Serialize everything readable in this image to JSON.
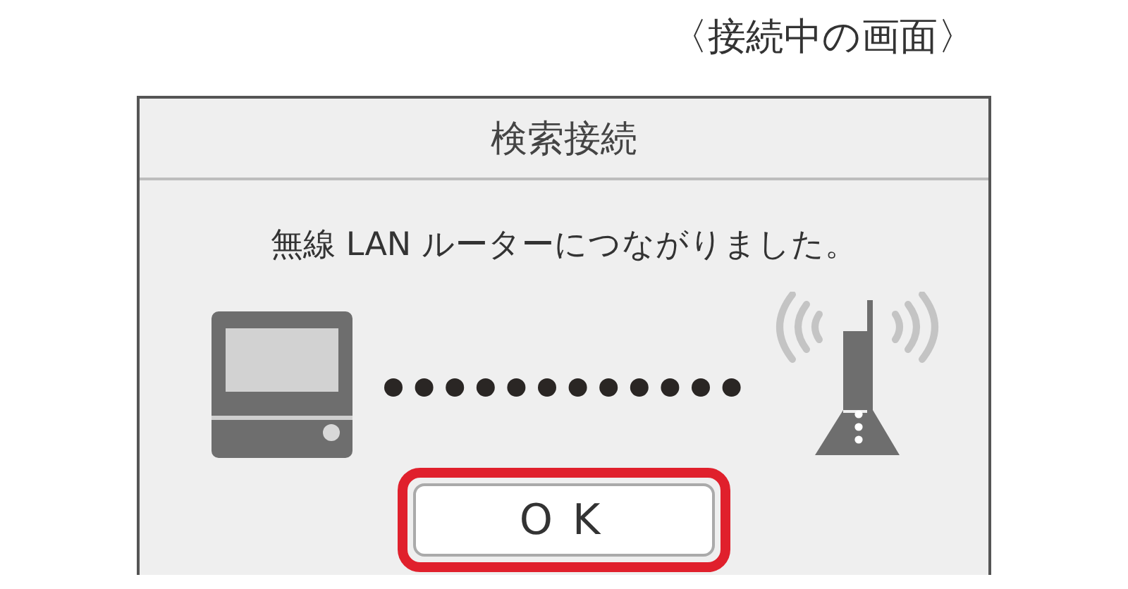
{
  "caption": "〈接続中の画面〉",
  "dialog": {
    "title": "検索接続",
    "message": "無線 LAN ルーターにつながりました。",
    "ok_button": {
      "label": "OK",
      "highlighted": true
    }
  }
}
